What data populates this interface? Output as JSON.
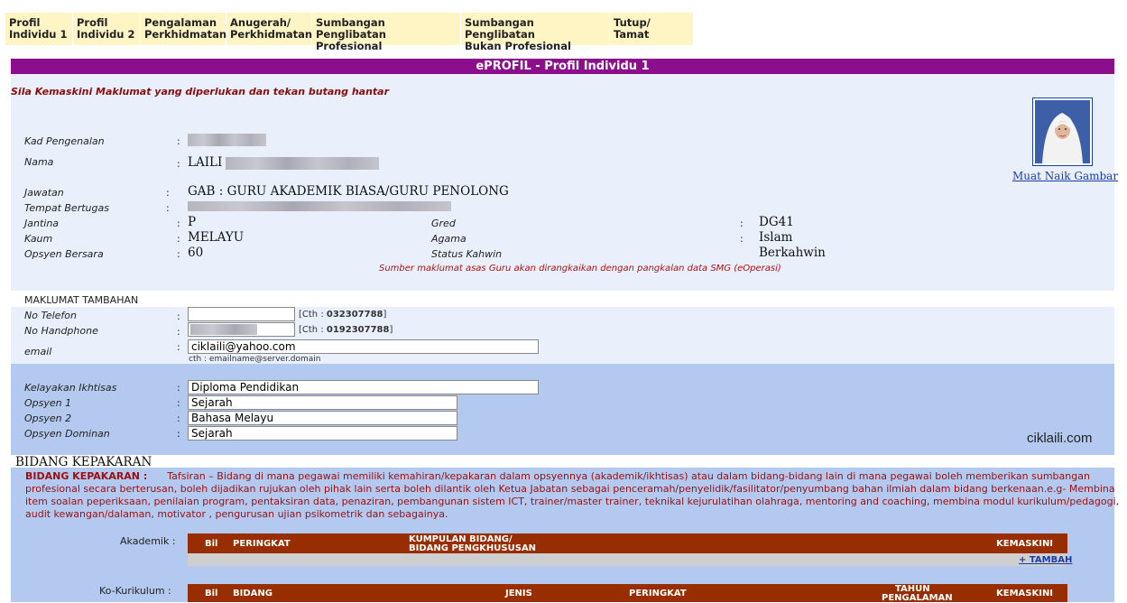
{
  "tabs": [
    {
      "line1": "Profil",
      "line2": "Individu 1"
    },
    {
      "line1": "Profil",
      "line2": "Individu 2"
    },
    {
      "line1": "Pengalaman",
      "line2": "Perkhidmatan"
    },
    {
      "line1": "Anugerah/",
      "line2": "Perkhidmatan"
    },
    {
      "line1": "Sumbangan Penglibatan",
      "line2": "Profesional"
    },
    {
      "line1": "Sumbangan Penglibatan",
      "line2": "Bukan Profesional"
    },
    {
      "line1": "Tutup/ Tamat",
      "line2": ""
    }
  ],
  "title": "ePROFIL - Profil Individu 1",
  "instruction": "Sila Kemaskini Maklumat yang diperlukan dan tekan butang hantar",
  "photo_link": "Muat Naik Gambar",
  "profile": {
    "kad_label": "Kad Pengenalan",
    "nama_label": "Nama",
    "nama_value": "LAILI",
    "jawatan_label": "Jawatan",
    "jawatan_value": "GAB : GURU AKADEMIK BIASA/GURU PENOLONG",
    "tempat_label": "Tempat Bertugas",
    "jantina_label": "Jantina",
    "jantina_value": "P",
    "kaum_label": "Kaum",
    "kaum_value": "MELAYU",
    "opsyen_bersara_label": "Opsyen Bersara",
    "opsyen_bersara_value": "60",
    "gred_label": "Gred",
    "gred_value": "DG41",
    "agama_label": "Agama",
    "agama_value": "Islam",
    "status_label": "Status Kahwin",
    "status_value": "Berkahwin",
    "source_note": "Sumber maklumat asas Guru akan dirangkaikan dengan pangkalan data SMG (eOperasi)"
  },
  "tambahan": {
    "heading": "MAKLUMAT TAMBAHAN",
    "telefon_label": "No Telefon",
    "telefon_value": "",
    "telefon_hint_prefix": "[Cth : ",
    "telefon_hint_num": "032307788",
    "telefon_hint_suffix": "]",
    "handphone_label": "No Handphone",
    "handphone_hint_prefix": "[Cth : ",
    "handphone_hint_num": "0192307788",
    "handphone_hint_suffix": "]",
    "email_label": "email",
    "email_value": "ciklaili@yahoo.com",
    "email_hint": "cth : emailname@server.domain"
  },
  "kelayakan": {
    "ikhtisas_label": "Kelayakan Ikhtisas",
    "ikhtisas_value": "Diploma Pendidikan",
    "opsyen1_label": "Opsyen 1",
    "opsyen1_value": "Sejarah",
    "opsyen2_label": "Opsyen 2",
    "opsyen2_value": "Bahasa Melayu",
    "dominan_label": "Opsyen Dominan",
    "dominan_value": "Sejarah",
    "watermark": "ciklaili.com"
  },
  "bidang": {
    "heading": "BIDANG KEPAKARAN",
    "desc_title": "BIDANG KEPAKARAN :",
    "desc_line1": "Tafsiran – Bidang di mana pegawai memiliki kemahiran/kepakaran dalam opsyennya (akademik/ikhtisas) atau dalam bidang-bidang lain di mana pegawai boleh memberikan sumbangan",
    "desc_line2": "profesional secara berterusan, boleh dijadikan rujukan oleh pihak lain serta boleh dilantik oleh Ketua Jabatan sebagai penceramah/penyelidik/fasilitator/penyumbang bahan ilmiah dalam bidang berkenaan.e.g- Membina",
    "desc_line3": "item soalan peperiksaan,  penilaian program, pentaksiran data, penaziran, pembangunan sistem ICT, trainer/master trainer, teknikal kejurulatihan olahraga,  mentoring and coaching, membina modul kurikulum/pedagogi,",
    "desc_line4": "audit kewangan/dalaman, motivator , pengurusan ujian psikometrik dan sebagainya.",
    "akademik_label": "Akademik :",
    "akademik_cols": {
      "bil": "Bil",
      "peringkat": "PERINGKAT",
      "kumpulan1": "KUMPULAN BIDANG/",
      "kumpulan2": "BIDANG PENGKHUSUSAN",
      "kemaskini": "KEMASKINI"
    },
    "tambah": "+ TAMBAH",
    "kokurikulum_label": "Ko-Kurikulum :",
    "ko_cols": {
      "bil": "Bil",
      "bidang": "BIDANG",
      "jenis": "JENIS",
      "peringkat": "PERINGKAT",
      "tahun1": "TAHUN",
      "tahun2": "PENGALAMAN",
      "kemaskini": "KEMASKINI"
    }
  }
}
